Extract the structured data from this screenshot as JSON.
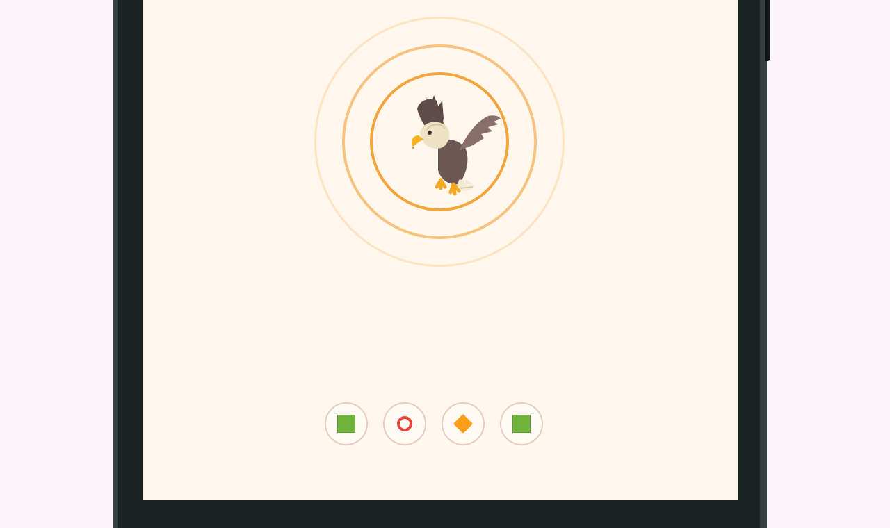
{
  "avatar": {
    "animal": "eagle-icon",
    "colors": {
      "ring_inner": "#f3a43a",
      "ring_mid": "#f7c27f",
      "ring_outer": "#fde3c2",
      "background": "#fff7ec"
    }
  },
  "options": [
    {
      "shape": "square",
      "color": "#6fb33a"
    },
    {
      "shape": "ring",
      "color": "#e6423a"
    },
    {
      "shape": "diamond",
      "color": "#ff9e1b"
    },
    {
      "shape": "square",
      "color": "#6fb33a"
    }
  ]
}
